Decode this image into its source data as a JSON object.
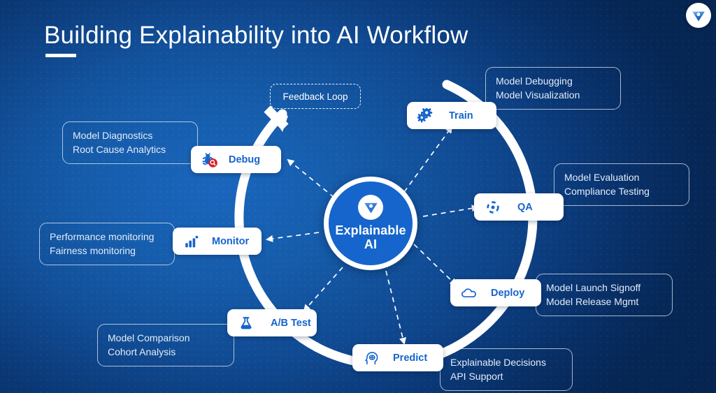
{
  "header": {
    "title": "Building Explainability into AI Workflow",
    "logo_icon": "company-triangle-logo"
  },
  "center": {
    "label_line1": "Explainable",
    "label_line2": "AI",
    "logo_icon": "company-triangle-logo"
  },
  "feedback": {
    "label": "Feedback Loop"
  },
  "colors": {
    "accent": "#1565cc",
    "pill_text": "#1565cc",
    "background_light": "#1a66bd",
    "background_dark": "#062a5c",
    "debug_badge": "#d81f26",
    "white": "#ffffff"
  },
  "nodes": [
    {
      "id": "train",
      "label": "Train",
      "icon": "gears-icon",
      "details": [
        "Model Debugging",
        "Model Visualization"
      ]
    },
    {
      "id": "qa",
      "label": "QA",
      "icon": "target-dashed-circle-icon",
      "details": [
        "Model Evaluation",
        "Compliance Testing"
      ]
    },
    {
      "id": "deploy",
      "label": "Deploy",
      "icon": "cloud-icon",
      "details": [
        "Model Launch Signoff",
        "Model Release Mgmt"
      ]
    },
    {
      "id": "predict",
      "label": "Predict",
      "icon": "head-brain-icon",
      "details": [
        "Explainable Decisions",
        "API  Support"
      ]
    },
    {
      "id": "abtest",
      "label": "A/B Test",
      "icon": "flask-icon",
      "details": [
        "Model Comparison",
        "Cohort Analysis"
      ]
    },
    {
      "id": "monitor",
      "label": "Monitor",
      "icon": "bar-chart-icon",
      "details": [
        "Performance monitoring",
        "Fairness monitoring"
      ]
    },
    {
      "id": "debug",
      "label": "Debug",
      "icon": "bug-magnifier-icon",
      "details": [
        "Model Diagnostics",
        "Root Cause Analytics"
      ]
    }
  ]
}
